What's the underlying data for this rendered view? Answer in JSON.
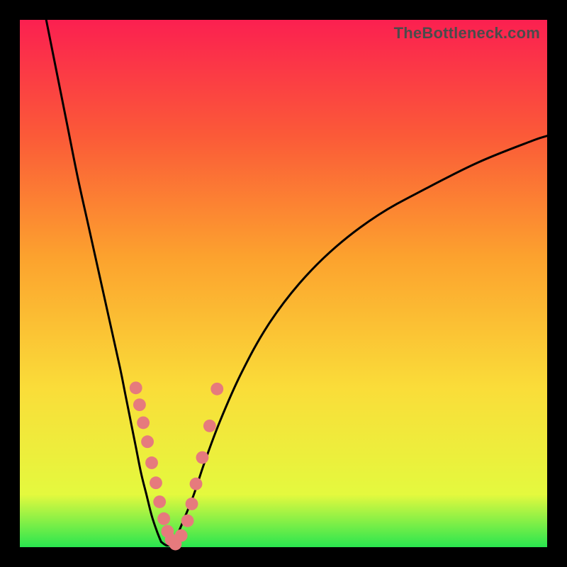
{
  "watermark": "TheBottleneck.com",
  "colors": {
    "frame": "#000000",
    "curve": "#000000",
    "marker": "#e67a7d",
    "gradient_stops": [
      {
        "offset_pct": 0,
        "color": "#29e64f"
      },
      {
        "offset_pct": 10,
        "color": "#e4f93e"
      },
      {
        "offset_pct": 30,
        "color": "#fadd39"
      },
      {
        "offset_pct": 55,
        "color": "#fca22e"
      },
      {
        "offset_pct": 78,
        "color": "#fb5a38"
      },
      {
        "offset_pct": 100,
        "color": "#fb2050"
      }
    ]
  },
  "chart_data": {
    "type": "line",
    "title": "",
    "xlabel": "",
    "ylabel": "",
    "x_range": [
      0,
      100
    ],
    "y_range": [
      0,
      100
    ],
    "note": "Axis values are normalized percentages of the plot area; no numeric tick labels are shown in the image.",
    "series": [
      {
        "name": "left-curve",
        "x": [
          5,
          7,
          9,
          11,
          13,
          15,
          17,
          19,
          20,
          21,
          22,
          23,
          24,
          25,
          26,
          26.8
        ],
        "y": [
          100,
          90,
          80,
          70,
          61,
          52,
          43,
          34,
          29,
          24,
          19,
          14,
          10,
          6,
          3,
          1
        ]
      },
      {
        "name": "valley-floor",
        "x": [
          26.8,
          28.0,
          29.3
        ],
        "y": [
          1,
          0.3,
          1
        ]
      },
      {
        "name": "right-curve",
        "x": [
          29.3,
          31,
          33,
          35,
          38,
          42,
          47,
          53,
          60,
          68,
          77,
          87,
          97,
          100
        ],
        "y": [
          1,
          5,
          10,
          16,
          24,
          33,
          42,
          50,
          57,
          63,
          68,
          73,
          77,
          78
        ]
      }
    ],
    "markers": {
      "name": "pink-dots",
      "x": [
        22.0,
        22.7,
        23.4,
        24.2,
        25.0,
        25.8,
        26.5,
        27.3,
        28.0,
        28.7,
        29.5,
        30.6,
        31.8,
        32.6,
        33.4,
        34.6,
        36.0,
        37.4
      ],
      "y": [
        30.2,
        27.0,
        23.6,
        20.0,
        16.0,
        12.2,
        8.6,
        5.4,
        3.0,
        1.4,
        0.6,
        2.2,
        5.0,
        8.2,
        12.0,
        17.0,
        23.0,
        30.0
      ],
      "r_pct": 1.2
    }
  }
}
